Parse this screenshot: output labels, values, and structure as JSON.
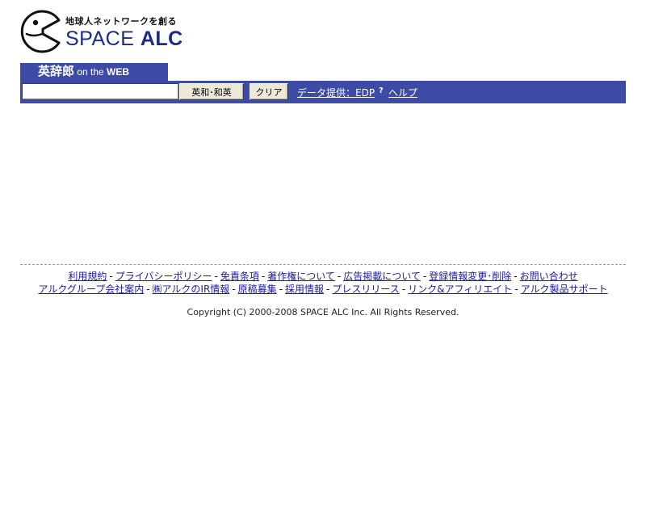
{
  "header": {
    "tagline": "地球人ネットワークを創る",
    "brand_space": "SPACE",
    "brand_alc": "ALC",
    "brand_color": "#1c2b86"
  },
  "search": {
    "product_jp": "英辞郎",
    "product_on": " on the ",
    "product_web": "WEB",
    "input_value": "",
    "search_button": "英和･和英",
    "clear_button": "クリア",
    "data_link": "データ提供：EDP",
    "help_icon": "?",
    "help_link": "ヘルプ",
    "bar_color": "#3d4aa6"
  },
  "footer": {
    "row1": [
      "利用規約",
      "プライバシーポリシー",
      "免責条項",
      "著作権について",
      "広告掲載について",
      "登録情報変更･削除",
      "お問い合わせ"
    ],
    "row2": [
      "アルクグループ会社案内",
      "㈱アルクのIR情報",
      "原稿募集",
      "採用情報",
      "プレスリリース",
      "リンク&アフィリエイト",
      "アルク製品サポート"
    ],
    "separator": "-",
    "copyright": "Copyright (C) 2000-2008 SPACE ALC Inc. All Rights Reserved."
  }
}
